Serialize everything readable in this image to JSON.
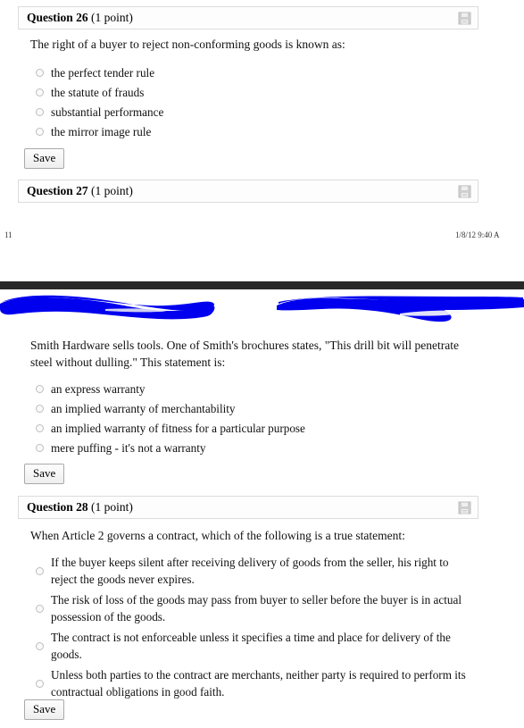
{
  "document": {
    "type": "online-quiz-printout",
    "background": "#ffffff"
  },
  "questions": [
    {
      "id": "question-26",
      "number_label": "Question 26",
      "points_label": "(1 point)",
      "save_icon": "floppy-disk-save-icon",
      "prompt": "The right of a buyer to reject non-conforming goods is known as:",
      "options": [
        "the perfect tender rule",
        "the statute of frauds",
        "substantial performance",
        "the mirror image rule"
      ],
      "selected_index": null,
      "save_label": "Save"
    },
    {
      "id": "question-27",
      "number_label": "Question 27",
      "points_label": "(1 point)",
      "save_icon": "floppy-disk-save-icon",
      "prompt": "Smith Hardware sells tools. One of Smith's brochures states, \"This drill bit will penetrate steel without dulling.\" This statement is:",
      "options": [
        "an express warranty",
        "an implied warranty of merchantability",
        "an implied warranty of fitness for a particular purpose",
        "mere puffing - it's not a warranty"
      ],
      "selected_index": null,
      "save_label": "Save"
    },
    {
      "id": "question-28",
      "number_label": "Question 28",
      "points_label": "(1 point)",
      "save_icon": "floppy-disk-save-icon",
      "prompt": "When Article 2 governs a contract, which of the following is a true statement:",
      "options": [
        "If the buyer keeps silent after receiving delivery of goods from the seller, his right to reject the goods never expires.",
        "The risk of loss of the goods may pass from buyer to seller before the buyer is in actual possession of the goods.",
        "The contract is not enforceable unless it specifies a time and place for delivery of the goods.",
        "Unless both parties to the contract are merchants, neither party is required to perform its contractual obligations in good faith."
      ],
      "selected_index": null,
      "save_label": "Save"
    }
  ],
  "footer": {
    "page_number": "11",
    "timestamp": "1/8/12 9:40 A"
  },
  "annotations": {
    "dark_bar_color": "#282828",
    "scribble_color": "#0000ee",
    "scribble_note": "two blue hand-drawn redaction strokes covering the page header / question 27 banner"
  }
}
